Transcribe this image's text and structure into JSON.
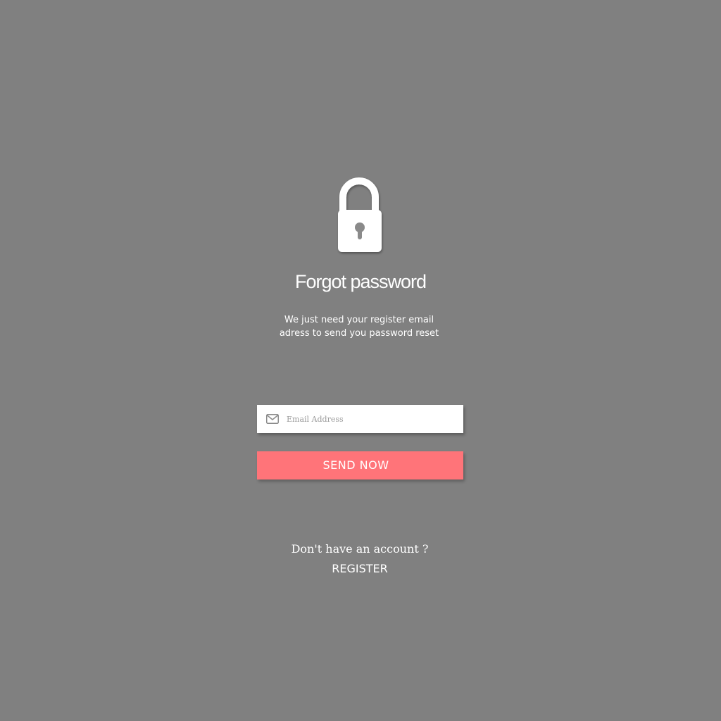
{
  "header": {
    "icon": "lock-icon",
    "title": "Forgot password",
    "subtitle_line1": "We just need your register email",
    "subtitle_line2": "adress to send you password reset"
  },
  "form": {
    "email_icon": "envelope-icon",
    "email_placeholder": "Email Address",
    "email_value": "",
    "send_label": "SEND NOW"
  },
  "footer": {
    "prompt": "Don't have an account ?",
    "register_label": "REGISTER"
  },
  "colors": {
    "background": "#808080",
    "accent": "#ff7479",
    "text": "#ffffff"
  }
}
